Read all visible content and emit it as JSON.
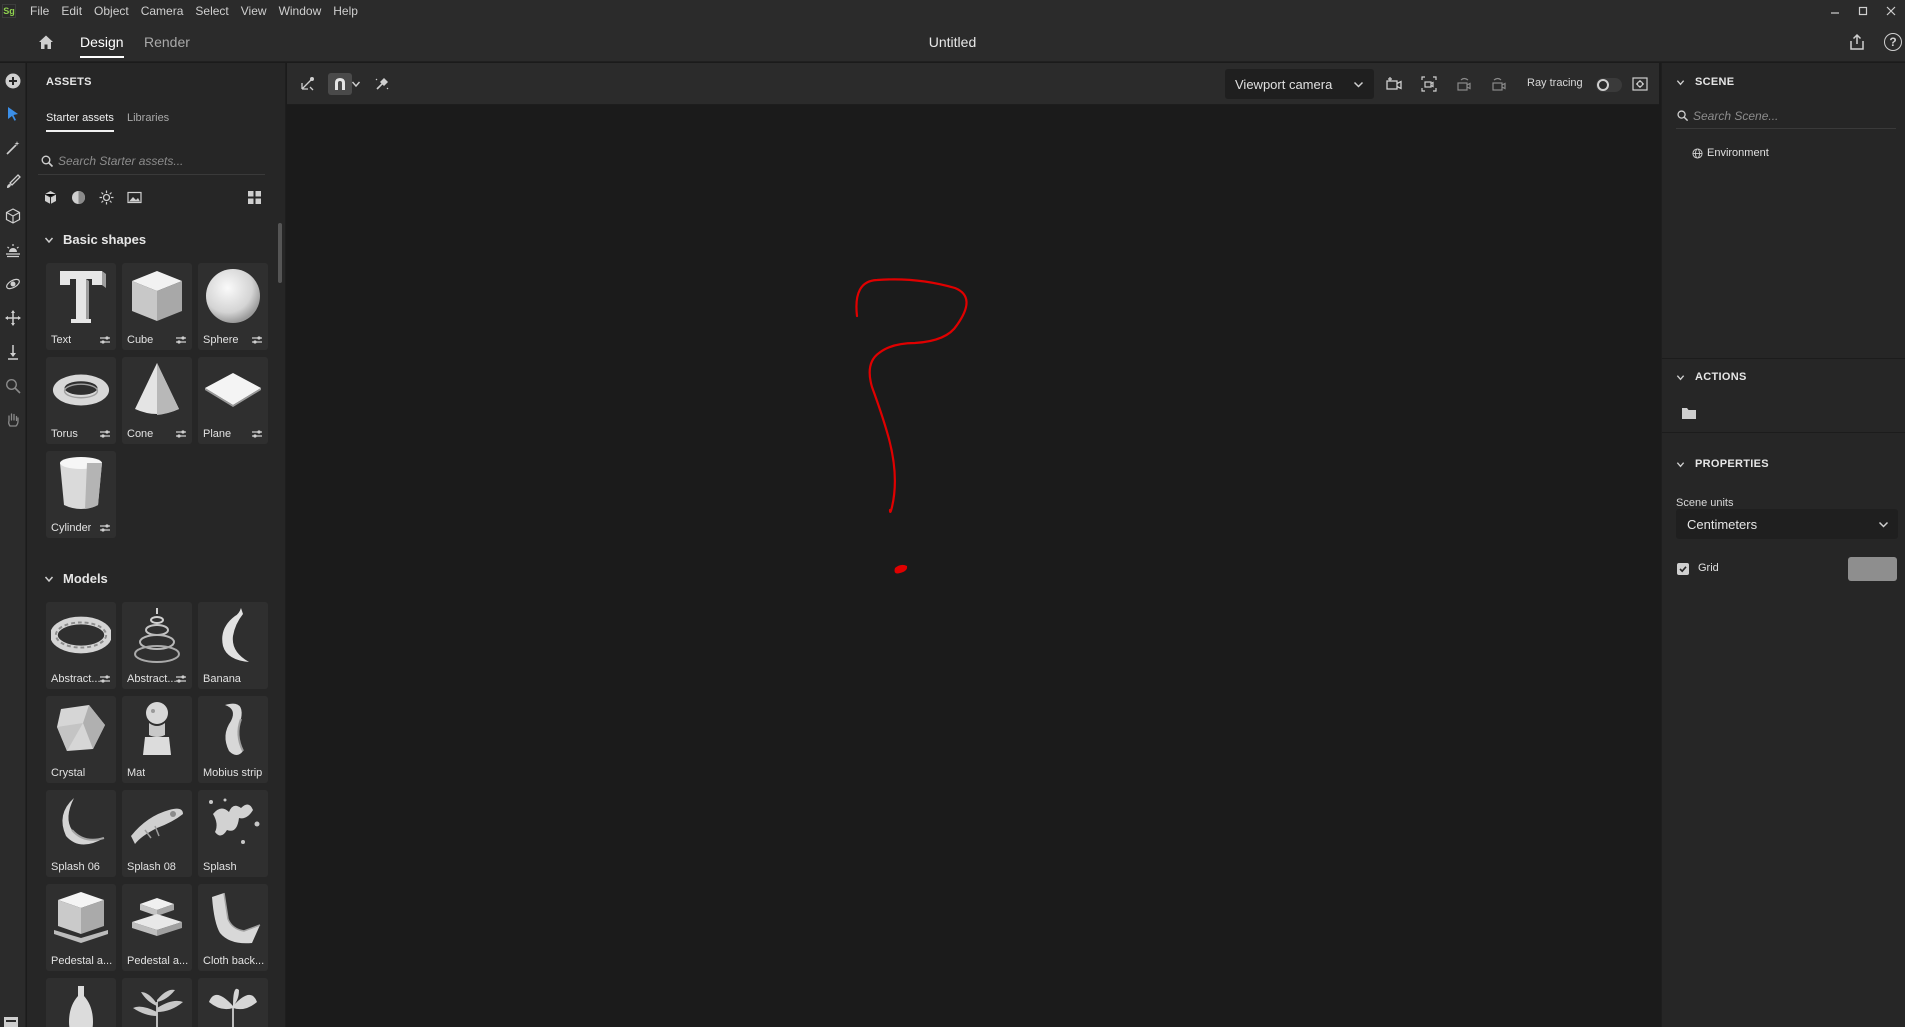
{
  "app": {
    "logo_text": "Sg",
    "menu": [
      "File",
      "Edit",
      "Object",
      "Camera",
      "Select",
      "View",
      "Window",
      "Help"
    ],
    "document_title": "Untitled"
  },
  "workspace_tabs": {
    "design": "Design",
    "render": "Render",
    "active": "Design"
  },
  "assets": {
    "title": "ASSETS",
    "tabs": {
      "starter": "Starter assets",
      "libraries": "Libraries"
    },
    "search_placeholder": "Search Starter assets...",
    "filters": [
      "models-icon",
      "materials-icon",
      "lights-icon",
      "images-icon"
    ],
    "sections": {
      "basic_shapes": {
        "title": "Basic shapes",
        "items": [
          "Text",
          "Cube",
          "Sphere",
          "Torus",
          "Cone",
          "Plane",
          "Cylinder"
        ]
      },
      "models": {
        "title": "Models",
        "items": [
          "Abstract...",
          "Abstract...",
          "Banana",
          "Crystal",
          "Mat",
          "Mobius strip",
          "Splash 06",
          "Splash 08",
          "Splash",
          "Pedestal a...",
          "Pedestal a...",
          "Cloth back..."
        ]
      }
    }
  },
  "viewport": {
    "camera": "Viewport camera",
    "ray_tracing_label": "Ray tracing",
    "ray_tracing_on": false,
    "annotation_color": "#e00000"
  },
  "scene_panel": {
    "title": "SCENE",
    "search_placeholder": "Search Scene...",
    "items": [
      "Environment"
    ]
  },
  "actions_panel": {
    "title": "ACTIONS"
  },
  "properties_panel": {
    "title": "PROPERTIES",
    "scene_units_label": "Scene units",
    "scene_units_value": "Centimeters",
    "grid_label": "Grid",
    "grid_checked": true,
    "grid_color": "#8e8e8e"
  },
  "colors": {
    "accent_select": "#3b8fe8",
    "panel": "#262626",
    "background": "#1b1b1b"
  }
}
